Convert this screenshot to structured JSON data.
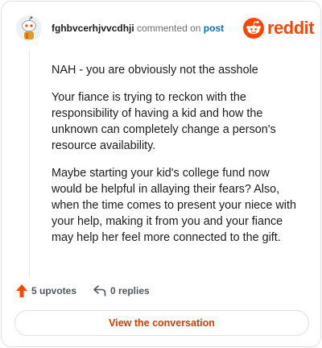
{
  "header": {
    "username": "fghbvcerhjvvcdhji",
    "action_text": "commented on",
    "post_link": "post",
    "brand_name": "reddit",
    "brand_color": "#ff4500"
  },
  "comment": {
    "paragraphs": [
      "NAH - you are obviously not the asshole",
      "Your fiance is trying to reckon with the responsibility of having a kid and how the unknown can completely change a person's resource availability.",
      "Maybe starting your kid's college fund now would be helpful in allaying their fears? Also, when the time comes to present your niece with your help, making it from you and your fiance may help her feel more connected to the gift."
    ]
  },
  "actions": {
    "upvotes_label": "5 upvotes",
    "replies_label": "0 replies",
    "upvote_icon": "upvote-arrow-icon",
    "reply_icon": "reply-arrow-icon"
  },
  "cta": {
    "label": "View the conversation",
    "color": "#d93a00"
  }
}
